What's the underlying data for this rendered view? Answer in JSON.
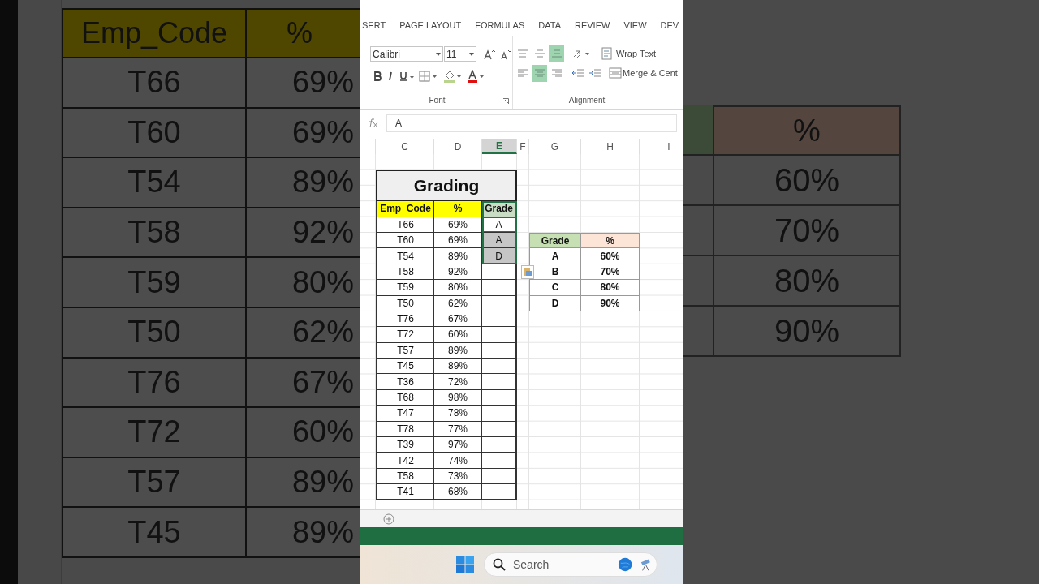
{
  "backdrop_left": {
    "columns": [
      "Emp_Code",
      "%"
    ],
    "rows": [
      [
        "T66",
        "69%"
      ],
      [
        "T60",
        "69%"
      ],
      [
        "T54",
        "89%"
      ],
      [
        "T58",
        "92%"
      ],
      [
        "T59",
        "80%"
      ],
      [
        "T50",
        "62%"
      ],
      [
        "T76",
        "67%"
      ],
      [
        "T72",
        "60%"
      ],
      [
        "T57",
        "89%"
      ],
      [
        "T45",
        "89%"
      ]
    ]
  },
  "ribbon": {
    "tabs": [
      "SERT",
      "PAGE LAYOUT",
      "FORMULAS",
      "DATA",
      "REVIEW",
      "VIEW",
      "DEV"
    ],
    "font_name": "Calibri",
    "font_size": "11",
    "font_group": "Font",
    "alignment_group": "Alignment",
    "wrap_text": "Wrap Text",
    "merge": "Merge & Cent",
    "alignment_buttons": [
      {
        "kind": "top",
        "pressed": false
      },
      {
        "kind": "middle",
        "pressed": false
      },
      {
        "kind": "bottom",
        "pressed": true
      },
      {
        "kind": "left",
        "pressed": false
      },
      {
        "kind": "center",
        "pressed": true
      },
      {
        "kind": "right",
        "pressed": false
      }
    ]
  },
  "formula_bar": {
    "value": "A"
  },
  "column_headers": [
    {
      "label": "C",
      "selected": false
    },
    {
      "label": "D",
      "selected": false
    },
    {
      "label": "E",
      "selected": true
    },
    {
      "label": "F",
      "selected": false
    },
    {
      "label": "G",
      "selected": false
    },
    {
      "label": "H",
      "selected": false
    },
    {
      "label": "I",
      "selected": false
    }
  ],
  "grading_table": {
    "title": "Grading",
    "columns": [
      "Emp_Code",
      "%",
      "Grade"
    ],
    "grade_header_selected": true,
    "rows": [
      {
        "emp_code": "T66",
        "percent": "69%",
        "grade": "A",
        "selected": true,
        "active": true
      },
      {
        "emp_code": "T60",
        "percent": "69%",
        "grade": "A",
        "selected": true,
        "active": false
      },
      {
        "emp_code": "T54",
        "percent": "89%",
        "grade": "D",
        "selected": true,
        "active": false
      },
      {
        "emp_code": "T58",
        "percent": "92%",
        "selected": false,
        "active": false
      },
      {
        "emp_code": "T59",
        "percent": "80%",
        "selected": false,
        "active": false
      },
      {
        "emp_code": "T50",
        "percent": "62%",
        "selected": false,
        "active": false
      },
      {
        "emp_code": "T76",
        "percent": "67%",
        "selected": false,
        "active": false
      },
      {
        "emp_code": "T72",
        "percent": "60%",
        "selected": false,
        "active": false
      },
      {
        "emp_code": "T57",
        "percent": "89%",
        "selected": false,
        "active": false
      },
      {
        "emp_code": "T45",
        "percent": "89%",
        "selected": false,
        "active": false
      },
      {
        "emp_code": "T36",
        "percent": "72%",
        "selected": false,
        "active": false
      },
      {
        "emp_code": "T68",
        "percent": "98%",
        "selected": false,
        "active": false
      },
      {
        "emp_code": "T47",
        "percent": "78%",
        "selected": false,
        "active": false
      },
      {
        "emp_code": "T78",
        "percent": "77%",
        "selected": false,
        "active": false
      },
      {
        "emp_code": "T39",
        "percent": "97%",
        "selected": false,
        "active": false
      },
      {
        "emp_code": "T42",
        "percent": "74%",
        "selected": false,
        "active": false
      },
      {
        "emp_code": "T58",
        "percent": "73%",
        "selected": false,
        "active": false
      },
      {
        "emp_code": "T41",
        "percent": "68%",
        "selected": false,
        "active": false
      }
    ]
  },
  "lookup_table": {
    "columns": [
      "Grade",
      "%"
    ],
    "rows": [
      [
        "A",
        "60%"
      ],
      [
        "B",
        "70%"
      ],
      [
        "C",
        "80%"
      ],
      [
        "D",
        "90%"
      ]
    ]
  },
  "taskbar": {
    "search_placeholder": "Search"
  },
  "backdrop_right": {
    "header": "%",
    "rows": [
      "60%",
      "70%",
      "80%",
      "90%"
    ]
  }
}
